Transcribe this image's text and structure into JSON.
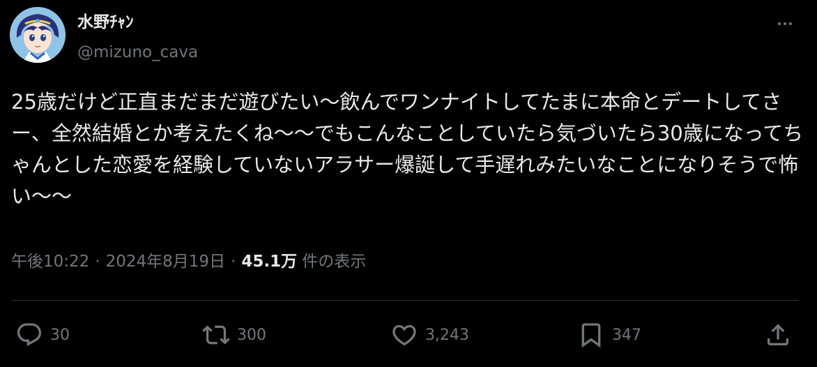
{
  "author": {
    "display_name": "水野ﾁｬﾝ",
    "handle": "@mizuno_cava"
  },
  "tweet": {
    "text": "25歳だけど正直まだまだ遊びたい〜飲んでワンナイトしてたまに本命とデートしてさー、全然結婚とか考えたくね〜〜でもこんなことしていたら気づいたら30歳になってちゃんとした恋愛を経験していないアラサー爆誕して手遅れみたいなことになりそうで怖い〜〜",
    "time": "午後10:22",
    "date": "2024年8月19日",
    "separator": "·",
    "views_count": "45.1万",
    "views_label": "件の表示"
  },
  "actions": {
    "reply_count": "30",
    "retweet_count": "300",
    "like_count": "3,243",
    "bookmark_count": "347"
  },
  "icons": {
    "reply": "speech-bubble-icon",
    "retweet": "retweet-arrows-icon",
    "like": "heart-icon",
    "bookmark": "bookmark-icon",
    "share": "share-upload-icon",
    "more": "more-dots-icon"
  },
  "colors": {
    "background": "#000000",
    "text": "#e7e9ea",
    "muted": "#71767b",
    "divider": "#2f3336"
  }
}
